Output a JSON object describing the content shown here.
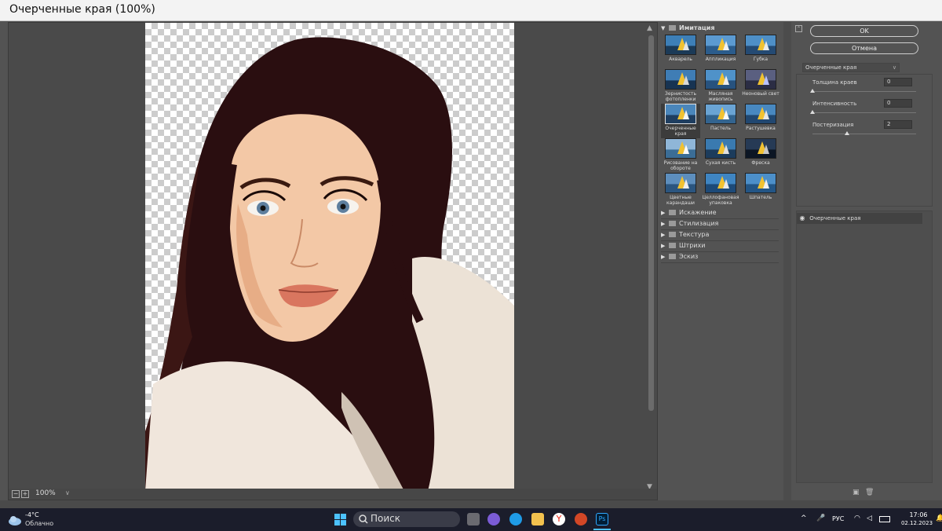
{
  "window": {
    "title": "Очерченные края (100%)"
  },
  "preview": {
    "zoom": "100%",
    "zoom_dropdown": "∨",
    "minus": "−",
    "plus": "+"
  },
  "gallery": {
    "open_category": "Имитация",
    "thumbnails": [
      {
        "label": "Акварель"
      },
      {
        "label": "Аппликация"
      },
      {
        "label": "Губка"
      },
      {
        "label": "Зернистость фотопленки"
      },
      {
        "label": "Масляная живопись"
      },
      {
        "label": "Неоновый свет"
      },
      {
        "label": "Очерченные края",
        "selected": true
      },
      {
        "label": "Пастель"
      },
      {
        "label": "Растушевка"
      },
      {
        "label": "Рисование на обороте"
      },
      {
        "label": "Сухая кисть"
      },
      {
        "label": "Фреска"
      },
      {
        "label": "Цветные карандаши"
      },
      {
        "label": "Целлофановая упаковка"
      },
      {
        "label": "Шпатель"
      }
    ],
    "categories": [
      "Искажение",
      "Стилизация",
      "Текстура",
      "Штрихи",
      "Эскиз"
    ]
  },
  "panel": {
    "ok": "OK",
    "cancel": "Отмена",
    "filter_select": "Очерченные края",
    "params": [
      {
        "label": "Толщина краев",
        "value": "0",
        "level": 0
      },
      {
        "label": "Интенсивность",
        "value": "0",
        "level": 0
      },
      {
        "label": "Постеризация",
        "value": "2",
        "level": 0.33
      }
    ],
    "layer": "Очерченные края"
  },
  "taskbar": {
    "temp": "-4°C",
    "weather": "Облачно",
    "search": "Поиск",
    "lang": "РУС",
    "time": "17:06",
    "date": "02.12.2023"
  },
  "colors": {
    "ps_gray": "#535353",
    "accent_blue": "#2f7fd6",
    "taskbar": "#1b1d2b"
  }
}
